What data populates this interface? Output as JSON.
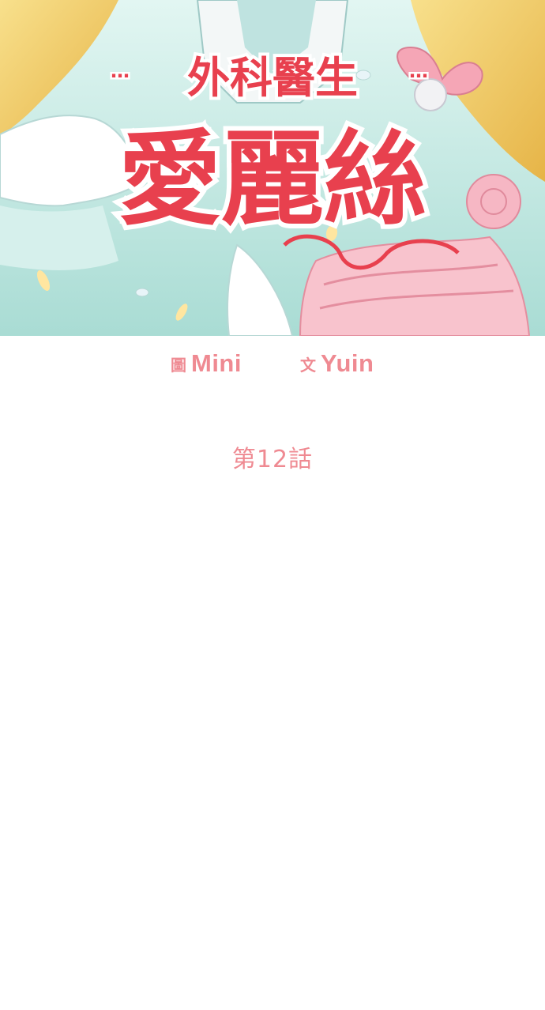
{
  "cover": {
    "subtitle": "外科醫生",
    "title": "愛麗絲",
    "colors": {
      "title_red": "#e8404e",
      "title_outline": "#ffffff",
      "dress_mint": "#bfe6df",
      "hair_gold": "#f3cf6a",
      "ribbon_pink": "#f5a6b6"
    }
  },
  "credits": {
    "art_role": "圖",
    "art_name": "Mini",
    "story_role": "文",
    "story_name": "Yuin"
  },
  "episode": {
    "label": "第12話"
  }
}
